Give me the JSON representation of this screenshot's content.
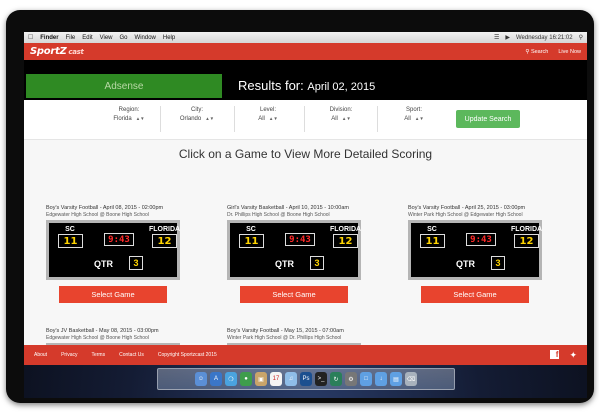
{
  "menubar": {
    "items": [
      "Finder",
      "File",
      "Edit",
      "View",
      "Go",
      "Window",
      "Help"
    ],
    "clock": "Wednesday 16:21:02"
  },
  "header": {
    "logo": "SportZ",
    "logo_tag": "cast",
    "search_label": "Search",
    "live_now_label": "Live Now"
  },
  "banner": {
    "adsense_label": "Adsense",
    "results_label": "Results for:",
    "results_date": "April 02, 2015"
  },
  "filters": {
    "region": {
      "label": "Region:",
      "value": "Florida"
    },
    "city": {
      "label": "City:",
      "value": "Orlando"
    },
    "level": {
      "label": "Level:",
      "value": "All"
    },
    "division": {
      "label": "Division:",
      "value": "All"
    },
    "sport": {
      "label": "Sport:",
      "value": "All"
    },
    "update_button": "Update Search"
  },
  "headline": "Click on a Game to View More Detailed Scoring",
  "games": [
    {
      "title": "Boy's Varsity Football - April 08, 2015 - 02:00pm",
      "matchup": "Edgewater High School @ Boone High School",
      "home_team": "SC",
      "away_team": "FLORIDA",
      "home_score": "11",
      "away_score": "12",
      "clock": "9:43",
      "qtr_label": "QTR",
      "qtr": "3",
      "button": "Select Game"
    },
    {
      "title": "Girl's Varsity Basketball - April 10, 2015 - 10:00am",
      "matchup": "Dr. Phillips High School @ Boone High School",
      "home_team": "SC",
      "away_team": "FLORIDA",
      "home_score": "11",
      "away_score": "12",
      "clock": "9:43",
      "qtr_label": "QTR",
      "qtr": "3",
      "button": "Select Game"
    },
    {
      "title": "Boy's Varsity Football - April 25, 2015 - 03:00pm",
      "matchup": "Winter Park High School @ Edgewater High School",
      "home_team": "SC",
      "away_team": "FLORIDA",
      "home_score": "11",
      "away_score": "12",
      "clock": "9:43",
      "qtr_label": "QTR",
      "qtr": "3",
      "button": "Select Game"
    },
    {
      "title": "Boy's JV Basketball - May 08, 2015 - 03:00pm",
      "matchup": "Edgewater High School @ Boone High School"
    },
    {
      "title": "Boy's Varsity Football - May 15, 2015 - 07:00am",
      "matchup": "Winter Park High School @ Dr. Phillips High School"
    }
  ],
  "footer": {
    "about": "About",
    "privacy": "Privacy",
    "terms": "Terms",
    "contact": "Contact Us",
    "copyright": "Copyright Sportzcast 2015"
  },
  "dock_icons": [
    "finder",
    "app-store",
    "safari",
    "game-center",
    "preview",
    "calendar",
    "itunes",
    "photoshop",
    "terminal",
    "time-machine",
    "system-preferences",
    "folder",
    "downloads",
    "documents",
    "trash"
  ]
}
